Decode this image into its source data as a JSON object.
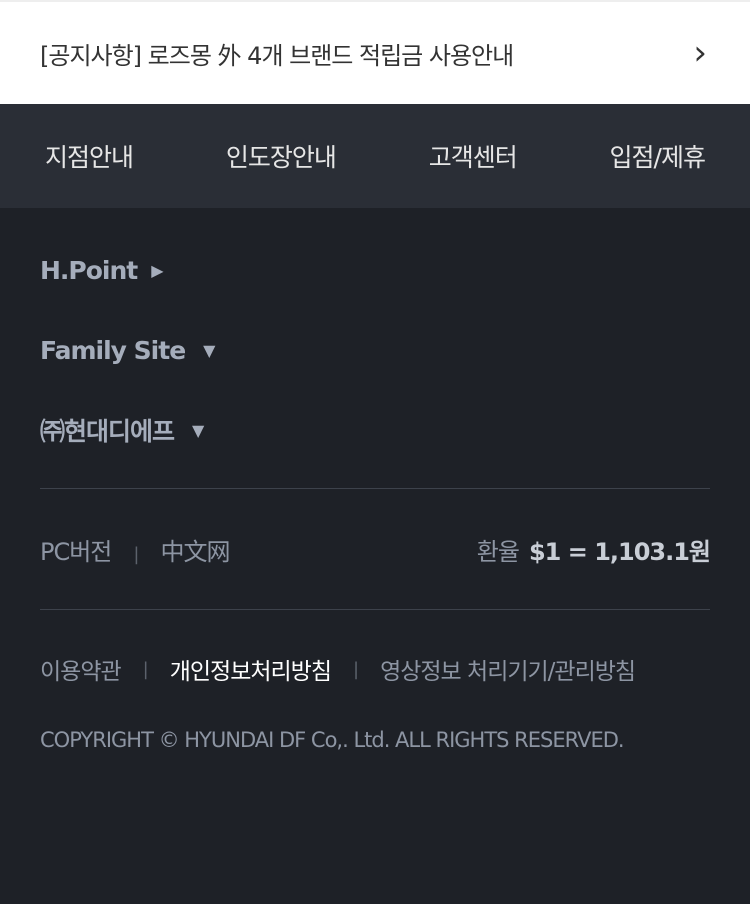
{
  "notice": {
    "text": "[공지사항] 로즈몽 外 4개 브랜드 적립금 사용안내",
    "chevron": "›"
  },
  "nav": [
    "지점안내",
    "인도장안내",
    "고객센터",
    "입점/제휴"
  ],
  "links": [
    {
      "label": "H.Point",
      "icon": "▶"
    },
    {
      "label": "Family Site",
      "icon": "▼"
    },
    {
      "label": "㈜현대디에프",
      "icon": "▼"
    }
  ],
  "version": {
    "pc": "PC버전",
    "sep": "|",
    "cn": "中文网"
  },
  "rate": {
    "label": "환율",
    "value": "$1 = 1,103.1원"
  },
  "policies": [
    "이용약관",
    "개인정보처리방침",
    "영상정보 처리기기/관리방침"
  ],
  "sep": "|",
  "copyright": "COPYRIGHT © HYUNDAI DF Co,. Ltd. ALL RIGHTS RESERVED."
}
